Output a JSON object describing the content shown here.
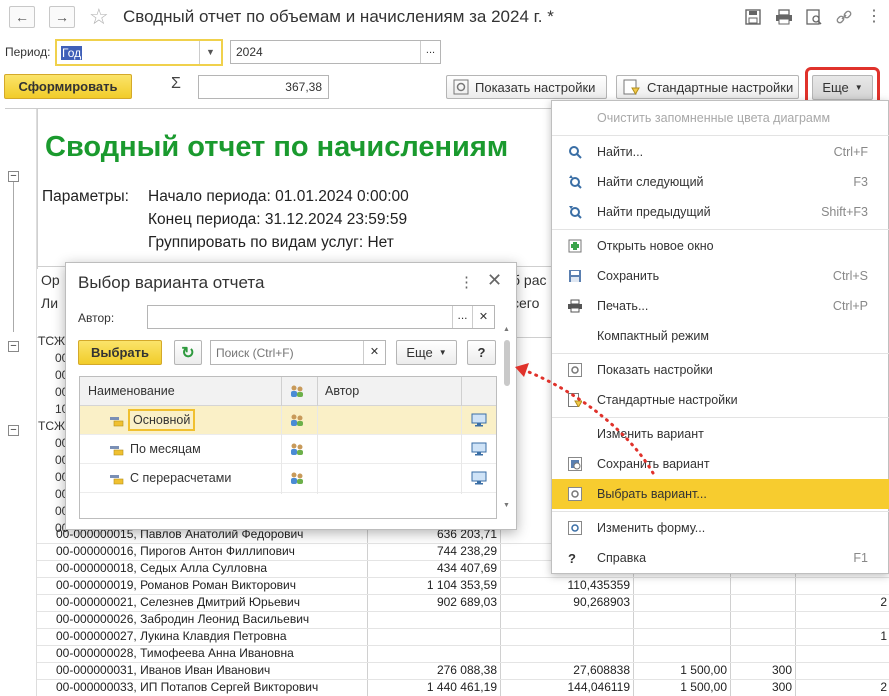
{
  "window": {
    "title": "Сводный отчет по объемам и начислениям за 2024 г. *",
    "nav_back": "←",
    "nav_forward": "→",
    "star": "☆"
  },
  "period": {
    "label": "Период:",
    "type_value": "Год",
    "year_value": "2024",
    "more": "..."
  },
  "toolbar": {
    "generate_label": "Сформировать",
    "sigma": "Σ",
    "sum_value": "367,38",
    "show_settings": "Показать настройки",
    "standard_settings": "Стандартные настройки",
    "more_label": "Еще"
  },
  "report": {
    "title": "Сводный отчет по начислениям",
    "params_label": "Параметры:",
    "param_start": "Начало периода: 01.01.2024 0:00:00",
    "param_end": "Конец периода: 31.12.2024 23:59:59",
    "param_group": "Группировать по видам услуг: Нет",
    "header_left1": "Ор",
    "header_left2": "Ли",
    "header_right1": "б рас",
    "header_right2": "сего",
    "partial_rows": [
      "ТСЖ",
      "00",
      "00",
      "00",
      "10",
      "ТСЖ",
      "00",
      "00",
      "00",
      "00",
      "00",
      "00"
    ],
    "rows": [
      {
        "name": "00-000000015, Павлов Анатолий Федорович",
        "v1": "636 203,71",
        "v2": "",
        "v3": "",
        "v4": "",
        "v5": ""
      },
      {
        "name": "00-000000016, Пирогов Антон Филлипович",
        "v1": "744 238,29",
        "v2": "",
        "v3": "",
        "v4": "",
        "v5": ""
      },
      {
        "name": "00-000000018, Седых Алла Сулловна",
        "v1": "434 407,69",
        "v2": "",
        "v3": "",
        "v4": "",
        "v5": ""
      },
      {
        "name": "00-000000019, Романов Роман Викторович",
        "v1": "1 104 353,59",
        "v2": "110,435359",
        "v3": "",
        "v4": "",
        "v5": ""
      },
      {
        "name": "00-000000021, Селезнев Дмитрий Юрьевич",
        "v1": "902 689,03",
        "v2": "90,268903",
        "v3": "",
        "v4": "",
        "v5": "2"
      },
      {
        "name": "00-000000026, Забродин Леонид Васильевич",
        "v1": "",
        "v2": "",
        "v3": "",
        "v4": "",
        "v5": ""
      },
      {
        "name": "00-000000027, Лукина Клавдия Петровна",
        "v1": "",
        "v2": "",
        "v3": "",
        "v4": "",
        "v5": "1"
      },
      {
        "name": "00-000000028, Тимофеева Анна Ивановна",
        "v1": "",
        "v2": "",
        "v3": "",
        "v4": "",
        "v5": ""
      },
      {
        "name": "00-000000031, Иванов Иван Иванович",
        "v1": "276 088,38",
        "v2": "27,608838",
        "v3": "1 500,00",
        "v4": "300",
        "v5": ""
      },
      {
        "name": "00-000000033, ИП Потапов Сергей Викторович",
        "v1": "1 440 461,19",
        "v2": "144,046119",
        "v3": "1 500,00",
        "v4": "300",
        "v5": "2"
      }
    ]
  },
  "menu": {
    "items": [
      {
        "label": "Очистить запомненные цвета диаграмм",
        "shortcut": "",
        "icon": "none",
        "disabled": true
      },
      {
        "label": "Найти...",
        "shortcut": "Ctrl+F",
        "icon": "search-icon"
      },
      {
        "label": "Найти следующий",
        "shortcut": "F3",
        "icon": "find-next-icon"
      },
      {
        "label": "Найти предыдущий",
        "shortcut": "Shift+F3",
        "icon": "find-previous-icon"
      },
      {
        "label": "Открыть новое окно",
        "shortcut": "",
        "icon": "new-window-icon"
      },
      {
        "label": "Сохранить",
        "shortcut": "Ctrl+S",
        "icon": "save-icon"
      },
      {
        "label": "Печать...",
        "shortcut": "Ctrl+P",
        "icon": "print-icon"
      },
      {
        "label": "Компактный режим",
        "shortcut": "",
        "icon": "none"
      },
      {
        "label": "Показать настройки",
        "shortcut": "",
        "icon": "settings-icon"
      },
      {
        "label": "Стандартные настройки",
        "shortcut": "",
        "icon": "standard-settings-icon"
      },
      {
        "label": "Изменить вариант",
        "shortcut": "",
        "icon": "none"
      },
      {
        "label": "Сохранить вариант",
        "shortcut": "",
        "icon": "save-variant-icon"
      },
      {
        "label": "Выбрать вариант...",
        "shortcut": "",
        "icon": "choose-variant-icon",
        "highlighted": true
      },
      {
        "label": "Изменить форму...",
        "shortcut": "",
        "icon": "form-icon"
      },
      {
        "label": "Справка",
        "shortcut": "F1",
        "icon": "help-icon"
      }
    ]
  },
  "dialog": {
    "title": "Выбор варианта отчета",
    "author_label": "Автор:",
    "author_value": "",
    "choose_label": "Выбрать",
    "search_placeholder": "Поиск (Ctrl+F)",
    "more_label": "Еще",
    "help_label": "?",
    "col_name": "Наименование",
    "col_author": "Автор",
    "variants": [
      {
        "name": "Основной",
        "author": "",
        "selected": true
      },
      {
        "name": "По месяцам",
        "author": "",
        "selected": false
      },
      {
        "name": "С перерасчетами",
        "author": "",
        "selected": false
      }
    ]
  },
  "colors": {
    "accent_yellow": "#f5d53c",
    "menu_highlight": "#f7cc2f",
    "title_green": "#1a9a2e",
    "annotation_red": "#e0322b"
  }
}
